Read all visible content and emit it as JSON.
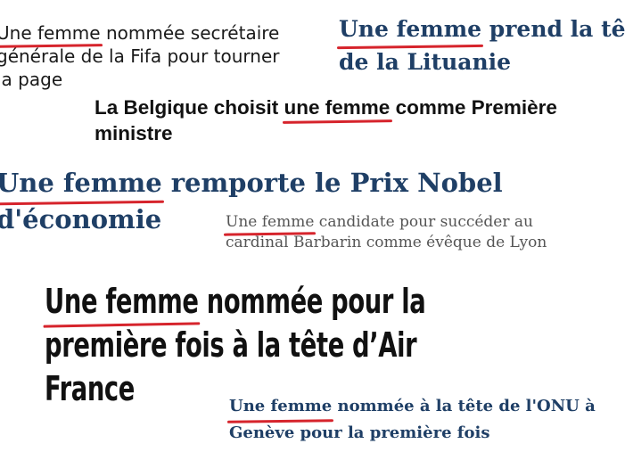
{
  "headlines": [
    {
      "lead": "Une femme",
      "rest": " nommée secrétaire",
      "lines": [
        "générale de la Fifa pour tourner",
        "la page"
      ]
    },
    {
      "lead": "Une femme",
      "rest": " prend la tête",
      "lines": [
        "de la Lituanie"
      ]
    },
    {
      "prefix": "La Belgique choisit ",
      "lead": "une femme",
      "rest": " comme Première",
      "lines": [
        "ministre"
      ]
    },
    {
      "lead": "Une femme",
      "rest": " remporte le Prix Nobel",
      "lines": [
        "d'économie"
      ]
    },
    {
      "lead": "Une femme",
      "rest": " candidate pour succéder au",
      "lines": [
        "cardinal Barbarin comme évêque de Lyon"
      ]
    },
    {
      "lead": "Une femme",
      "rest": " nommée pour la",
      "lines": [
        "première fois à la tête d’Air",
        "France"
      ]
    },
    {
      "lead": "Une femme",
      "rest": " nommée à la tête de l'ONU à",
      "lines": [
        "Genève pour la première fois"
      ]
    }
  ],
  "colors": {
    "underline": "#d6242c",
    "navy": "#1f3f66",
    "dark": "#111111",
    "gray": "#555555"
  }
}
